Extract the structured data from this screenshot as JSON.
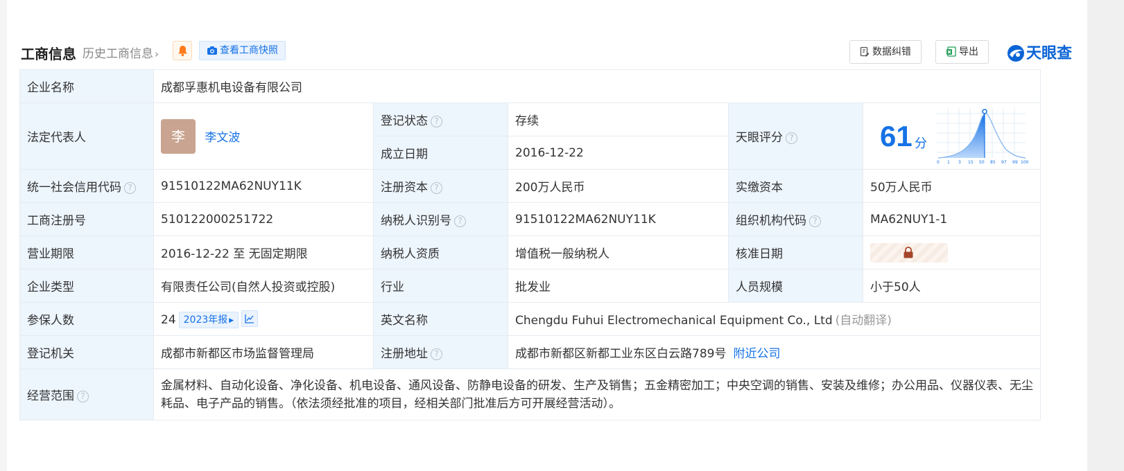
{
  "header": {
    "title": "工商信息",
    "history_link": "历史工商信息",
    "history_chevron": "›",
    "snapshot_button": "查看工商快照",
    "correct_button": "数据纠错",
    "export_button": "导出",
    "brand": "天眼查"
  },
  "rows": {
    "company_name": {
      "label": "企业名称",
      "value": "成都孚惠机电设备有限公司"
    },
    "legal_rep": {
      "label": "法定代表人",
      "avatar_char": "李",
      "name": "李文波"
    },
    "reg_status": {
      "label": "登记状态",
      "value": "存续"
    },
    "founded": {
      "label": "成立日期",
      "value": "2016-12-22"
    },
    "tianyan_score": {
      "label": "天眼评分",
      "score": "61",
      "unit": "分",
      "axis": [
        "0",
        "1",
        "3",
        "15",
        "50",
        "85",
        "97",
        "99",
        "100"
      ]
    },
    "credit_code": {
      "label": "统一社会信用代码",
      "value": "91510122MA62NUY11K"
    },
    "reg_capital": {
      "label": "注册资本",
      "value": "200万人民币"
    },
    "paid_capital": {
      "label": "实缴资本",
      "value": "50万人民币"
    },
    "reg_number": {
      "label": "工商注册号",
      "value": "510122000251722"
    },
    "taxpayer_id": {
      "label": "纳税人识别号",
      "value": "91510122MA62NUY11K"
    },
    "org_code": {
      "label": "组织机构代码",
      "value": "MA62NUY1-1"
    },
    "term": {
      "label": "营业期限",
      "value": "2016-12-22 至 无固定期限"
    },
    "taxpayer_qual": {
      "label": "纳税人资质",
      "value": "增值税一般纳税人"
    },
    "approval_date": {
      "label": "核准日期"
    },
    "company_type": {
      "label": "企业类型",
      "value": "有限责任公司(自然人投资或控股)"
    },
    "industry": {
      "label": "行业",
      "value": "批发业"
    },
    "staff_size": {
      "label": "人员规模",
      "value": "小于50人"
    },
    "insured": {
      "label": "参保人数",
      "value": "24",
      "report_tag": "2023年报"
    },
    "english_name": {
      "label": "英文名称",
      "value": "Chengdu Fuhui Electromechanical Equipment Co., Ltd",
      "note": "(自动翻译)"
    },
    "registry": {
      "label": "登记机关",
      "value": "成都市新都区市场监督管理局"
    },
    "address": {
      "label": "注册地址",
      "value": "成都市新都区新都工业东区白云路789号",
      "nearby": "附近公司"
    },
    "scope": {
      "label": "经营范围",
      "value": "金属材料、自动化设备、净化设备、机电设备、通风设备、防静电设备的研发、生产及销售；五金精密加工；中央空调的销售、安装及维修；办公用品、仪器仪表、无尘耗品、电子产品的销售。（依法须经批准的项目，经相关部门批准后方可开展经营活动）。"
    }
  },
  "colors": {
    "accent": "#1672e6",
    "label_bg": "#edf5fd",
    "status_green": "#1aa36d",
    "avatar": "#c9a490"
  }
}
